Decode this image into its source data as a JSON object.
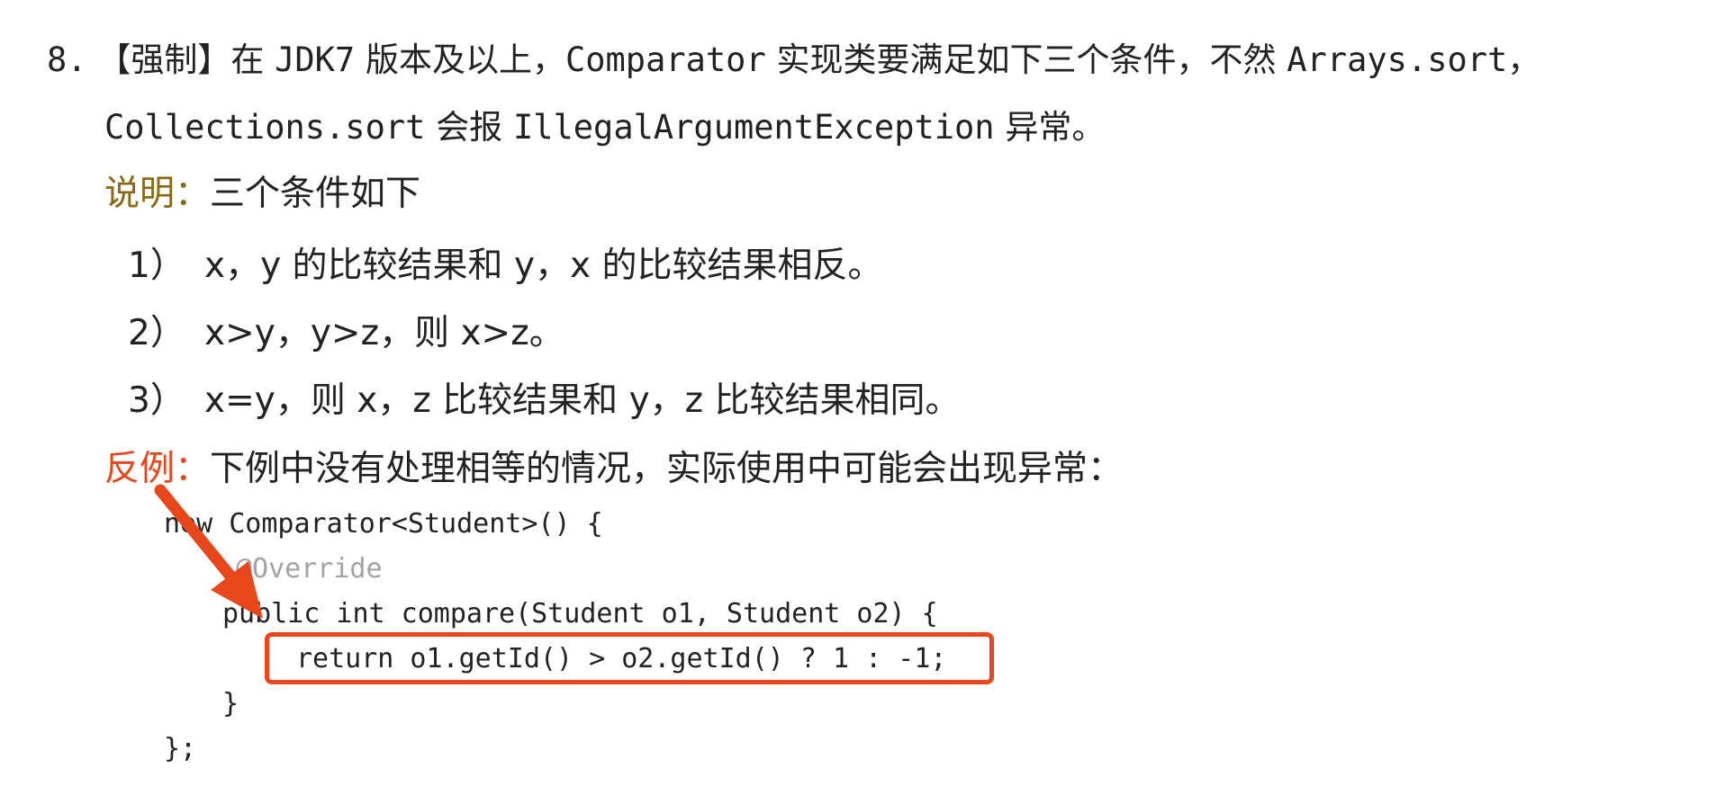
{
  "rule": {
    "number": "8.",
    "tag": "【强制】",
    "text1": "在 ",
    "jdk": "JDK7",
    "text2": " 版本及以上，",
    "comparator": "Comparator",
    "text3": " 实现类要满足如下三个条件，不然 ",
    "arrays_sort": "Arrays.sort，",
    "collections_sort": "Collections.sort",
    "text4": " 会报 ",
    "exception": "IllegalArgumentException",
    "text5": " 异常。"
  },
  "explanation": {
    "label": "说明：",
    "text": "三个条件如下"
  },
  "conditions": [
    {
      "num": "1）",
      "text": "x，y 的比较结果和 y，x 的比较结果相反。"
    },
    {
      "num": "2）",
      "text": "x>y，y>z，则 x>z。"
    },
    {
      "num": "3）",
      "text": "x=y，则 x，z 比较结果和 y，z 比较结果相同。"
    }
  ],
  "counter_example": {
    "label": "反例：",
    "text": "下例中没有处理相等的情况，实际使用中可能会出现异常："
  },
  "code": {
    "line1": "new Comparator<Student>() {",
    "line2": "@Override",
    "line3": "public int compare(Student o1, Student o2) {",
    "line4": "return o1.getId() > o2.getId() ? 1 : -1;",
    "line5": "}",
    "line6": "};"
  },
  "colors": {
    "accent_red": "#e8471c",
    "label_olive": "#8b6914",
    "comment_gray": "#a3a3a3"
  },
  "icons": {
    "arrow": "red-arrow-icon"
  }
}
